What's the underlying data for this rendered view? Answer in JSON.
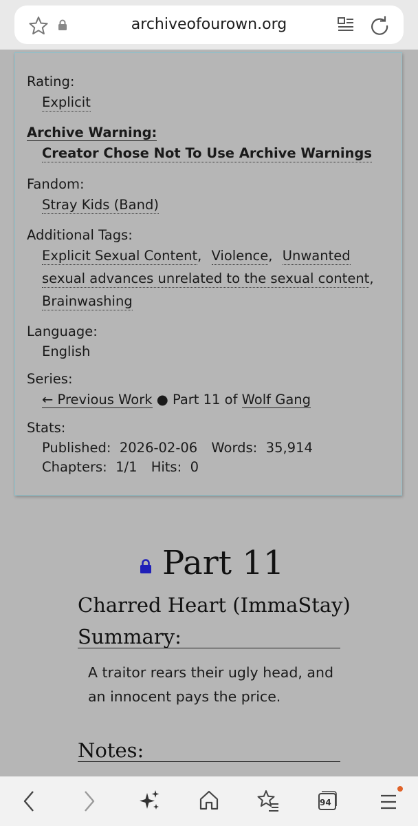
{
  "browser": {
    "url": "archiveofourown.org",
    "tab_count": "94",
    "accent_dot": "#e0632a"
  },
  "meta": {
    "rating_label": "Rating:",
    "rating_value": "Explicit",
    "warning_label": "Archive Warning:",
    "warning_value": "Creator Chose Not To Use Archive Warnings",
    "fandom_label": "Fandom:",
    "fandom_value": "Stray Kids (Band)",
    "tags_label": "Additional Tags:",
    "tags": [
      "Explicit Sexual Content",
      "Violence",
      "Unwanted",
      "sexual advances unrelated to the sexual content",
      "Brainwashing"
    ],
    "language_label": "Language:",
    "language_value": "English",
    "series_label": "Series:",
    "series_prev": "← Previous Work",
    "series_bullet": "●",
    "series_part": "Part 11 of",
    "series_name": "Wolf Gang",
    "stats_label": "Stats:",
    "published_label": "Published:",
    "published_value": "2026-02-06",
    "words_label": "Words:",
    "words_value": "35,914",
    "chapters_label": "Chapters:",
    "chapters_value": "1/1",
    "hits_label": "Hits:",
    "hits_value": "0"
  },
  "work": {
    "title": "Part 11",
    "subtitle": "Charred Heart (ImmaStay)",
    "summary_heading": "Summary:",
    "summary_text": "A traitor rears their ugly head, and an innocent pays the price.",
    "notes_heading": "Notes:",
    "lock_color": "#1f1fb8"
  }
}
